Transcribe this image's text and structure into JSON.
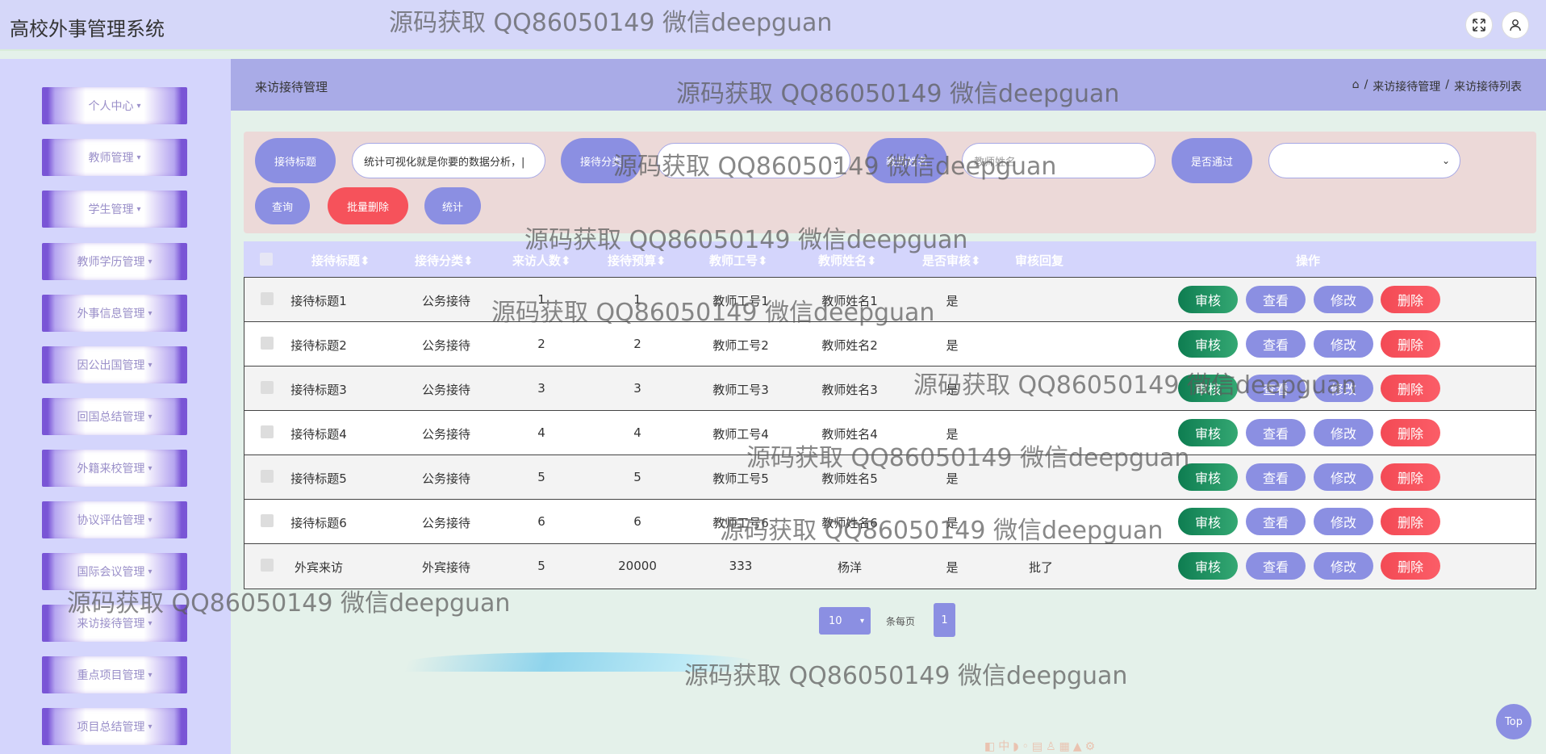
{
  "app": {
    "title": "高校外事管理系统"
  },
  "top_icons": [
    "fullscreen-icon",
    "user-icon"
  ],
  "sidebar": {
    "items": [
      {
        "label": "个人中心"
      },
      {
        "label": "教师管理"
      },
      {
        "label": "学生管理"
      },
      {
        "label": "教师学历管理"
      },
      {
        "label": "外事信息管理"
      },
      {
        "label": "因公出国管理"
      },
      {
        "label": "回国总结管理"
      },
      {
        "label": "外籍来校管理"
      },
      {
        "label": "协议评估管理"
      },
      {
        "label": "国际会议管理"
      },
      {
        "label": "来访接待管理"
      },
      {
        "label": "重点项目管理"
      },
      {
        "label": "项目总结管理"
      }
    ],
    "caret": "▾"
  },
  "page": {
    "title": "来访接待管理",
    "breadcrumb": [
      "来访接待管理",
      "来访接待列表"
    ],
    "breadcrumb_sep": "/"
  },
  "search": {
    "title_label": "接待标题",
    "title_value": "统计可视化就是你要的数据分析，|",
    "category_label": "接待分类",
    "category_value": "",
    "teacher_label": "教师姓名",
    "teacher_placeholder": "教师姓名",
    "passed_label": "是否通过",
    "passed_value": "",
    "query_button": "查询",
    "batch_delete_button": "批量删除",
    "stats_button": "统计"
  },
  "table": {
    "headers": [
      "接待标题",
      "接待分类",
      "来访人数",
      "接待预算",
      "教师工号",
      "教师姓名",
      "是否审核",
      "审核回复",
      "操作"
    ],
    "sort_glyph": "⬍",
    "rows": [
      {
        "title": "接待标题1",
        "category": "公务接待",
        "visitors": "1",
        "budget": "1",
        "teacher_no": "教师工号1",
        "teacher_name": "教师姓名1",
        "audited": "是",
        "reply": ""
      },
      {
        "title": "接待标题2",
        "category": "公务接待",
        "visitors": "2",
        "budget": "2",
        "teacher_no": "教师工号2",
        "teacher_name": "教师姓名2",
        "audited": "是",
        "reply": ""
      },
      {
        "title": "接待标题3",
        "category": "公务接待",
        "visitors": "3",
        "budget": "3",
        "teacher_no": "教师工号3",
        "teacher_name": "教师姓名3",
        "audited": "是",
        "reply": ""
      },
      {
        "title": "接待标题4",
        "category": "公务接待",
        "visitors": "4",
        "budget": "4",
        "teacher_no": "教师工号4",
        "teacher_name": "教师姓名4",
        "audited": "是",
        "reply": ""
      },
      {
        "title": "接待标题5",
        "category": "公务接待",
        "visitors": "5",
        "budget": "5",
        "teacher_no": "教师工号5",
        "teacher_name": "教师姓名5",
        "audited": "是",
        "reply": ""
      },
      {
        "title": "接待标题6",
        "category": "公务接待",
        "visitors": "6",
        "budget": "6",
        "teacher_no": "教师工号6",
        "teacher_name": "教师姓名6",
        "audited": "是",
        "reply": ""
      },
      {
        "title": "外宾来访",
        "category": "外宾接待",
        "visitors": "5",
        "budget": "20000",
        "teacher_no": "333",
        "teacher_name": "杨洋",
        "audited": "是",
        "reply": "批了"
      }
    ],
    "actions": {
      "audit": "审核",
      "view": "查看",
      "edit": "修改",
      "delete": "删除"
    }
  },
  "pagination": {
    "page_size": "10",
    "per_page_label": "条每页",
    "current_page": "1"
  },
  "back_to_top": "Top",
  "watermark": "源码获取 QQ86050149 微信deepguan",
  "colors": {
    "accent": "#8b8fe2",
    "danger": "#f6525b",
    "success": "#0e7d51",
    "header_bg": "#d5d7f9",
    "page_bg": "#e4f1ea"
  }
}
